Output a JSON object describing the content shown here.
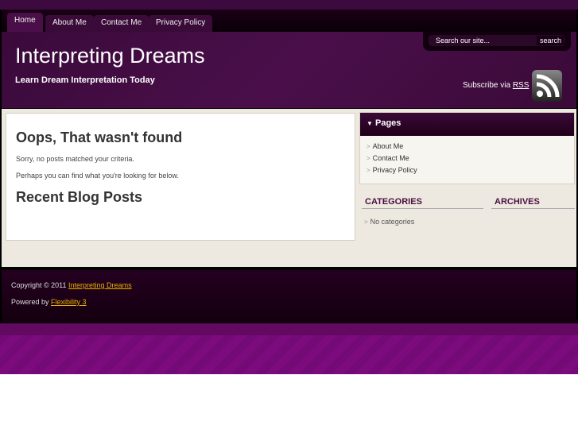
{
  "nav": {
    "tabs": [
      "Home",
      "About Me",
      "Contact Me",
      "Privacy Policy"
    ]
  },
  "header": {
    "title": "Interpreting Dreams",
    "tagline": "Learn Dream Interpretation Today",
    "search_placeholder": "Search our site...",
    "search_button": "search",
    "subscribe": "Subscribe via",
    "rss": "RSS"
  },
  "main": {
    "heading": "Oops, That wasn't found",
    "p1": "Sorry, no posts matched your criteria.",
    "p2": "Perhaps you can find what you're looking for below.",
    "recent": "Recent Blog Posts"
  },
  "sidebar": {
    "pages_title": "Pages",
    "pages": [
      "About Me",
      "Contact Me",
      "Privacy Policy"
    ],
    "categories_title": "CATEGORIES",
    "no_categories": "No categories",
    "archives_title": "ARCHIVES"
  },
  "footer": {
    "copyright": "Copyright © 2011",
    "site_link": "Interpreting Dreams",
    "powered": "Powered by",
    "theme_link": "Flexibility 3"
  }
}
